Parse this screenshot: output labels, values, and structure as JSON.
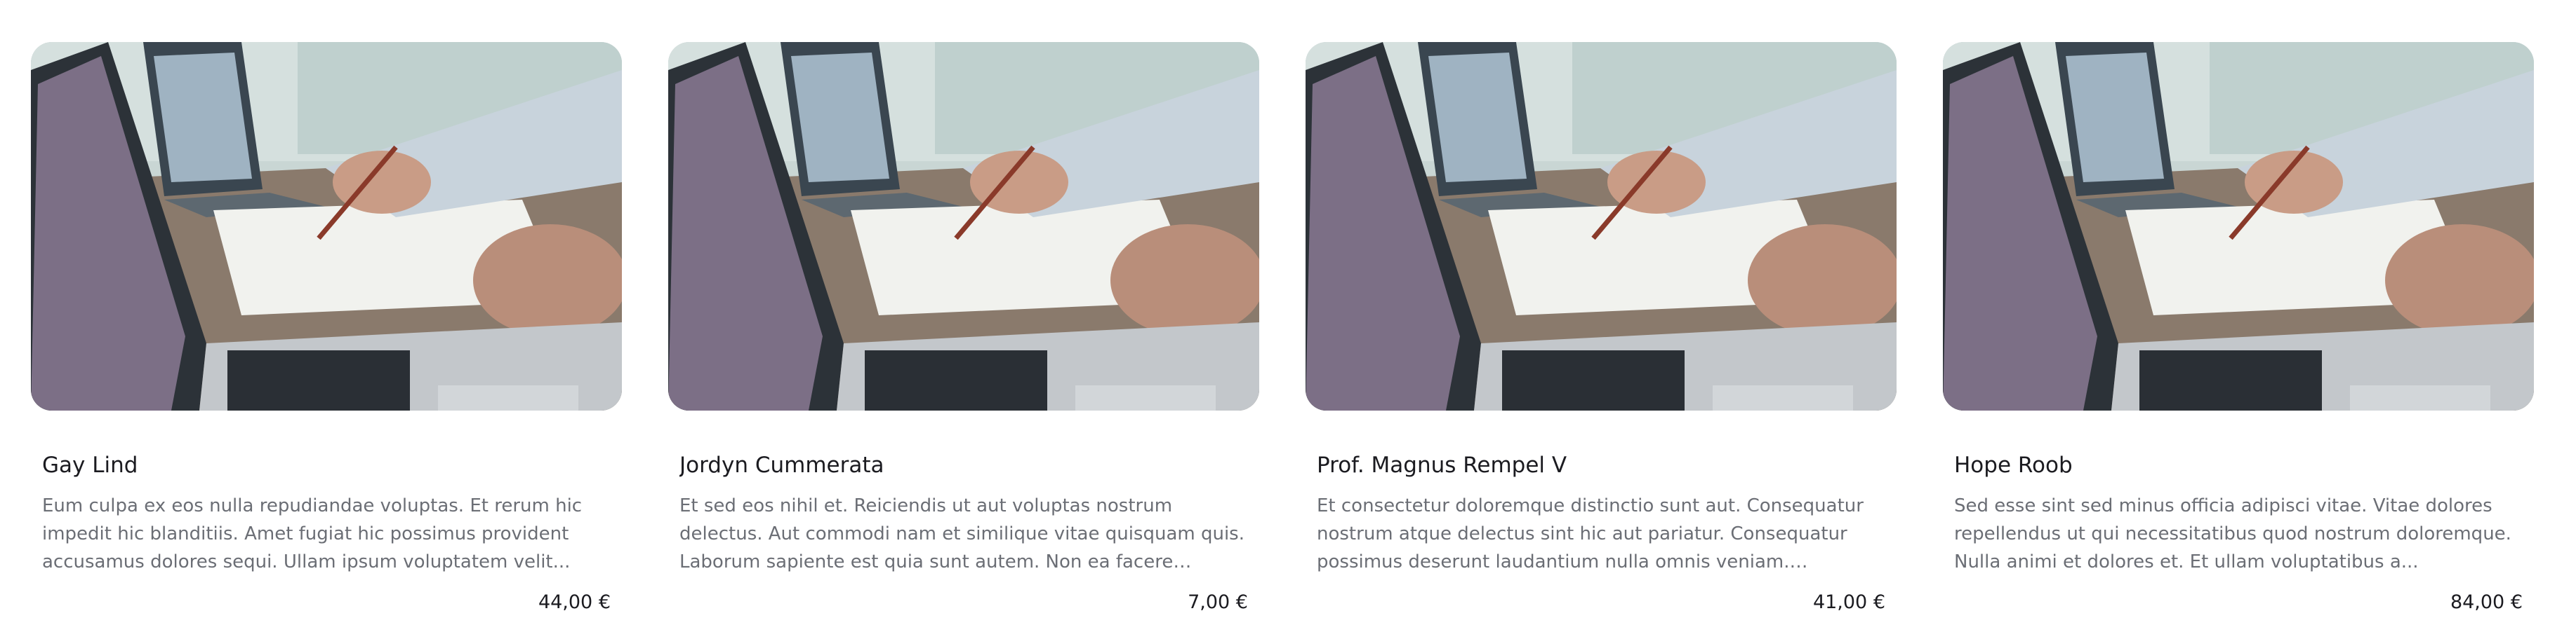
{
  "products": [
    {
      "name": "Gay Lind",
      "description": "Eum culpa ex eos nulla repudiandae voluptas. Et rerum hic impedit hic blanditiis. Amet fugiat hic possimus provident accusamus dolores sequi. Ullam ipsum voluptatem velit...",
      "price": "44,00 €"
    },
    {
      "name": "Jordyn Cummerata",
      "description": "Et sed eos nihil et. Reiciendis ut aut voluptas nostrum delectus. Aut commodi nam et similique vitae quisquam quis. Laborum sapiente est quia sunt autem. Non ea facere quibusdam...",
      "price": "7,00 €"
    },
    {
      "name": "Prof. Magnus Rempel V",
      "description": "Et consectetur doloremque distinctio sunt aut. Consequatur nostrum atque delectus sint hic aut pariatur. Consequatur possimus deserunt laudantium nulla omnis veniam. Dolorem...",
      "price": "41,00 €"
    },
    {
      "name": "Hope Roob",
      "description": "Sed esse sint sed minus officia adipisci vitae. Vitae dolores repellendus ut qui necessitatibus quod nostrum doloremque. Nulla animi et dolores et. Et ullam voluptatibus a...",
      "price": "84,00 €"
    }
  ]
}
